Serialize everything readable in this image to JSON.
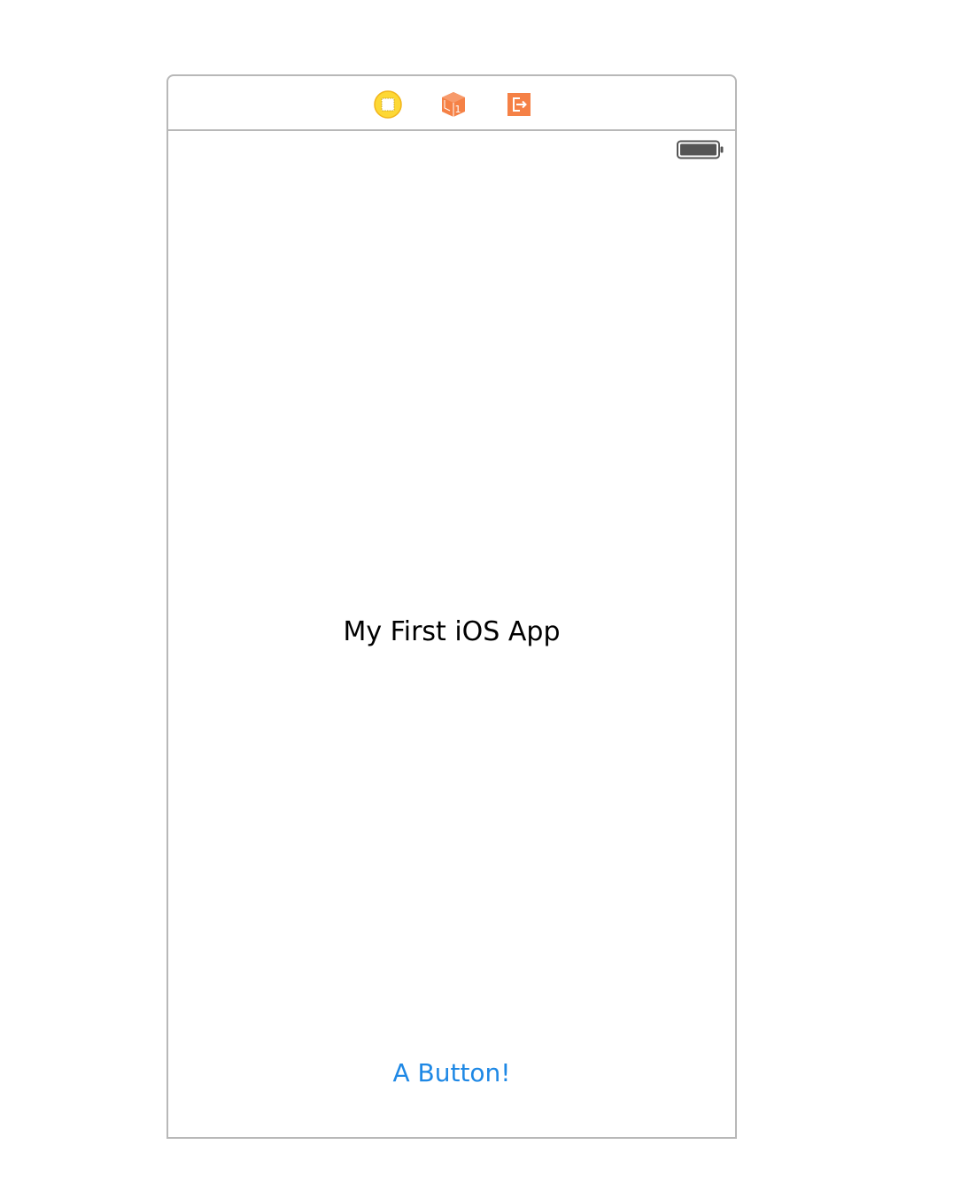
{
  "scene": {
    "dock": {
      "icons": [
        {
          "name": "view-controller-icon",
          "color": "#fdd835"
        },
        {
          "name": "first-responder-icon",
          "color": "#f58146",
          "badge": "1"
        },
        {
          "name": "exit-icon",
          "color": "#f58146"
        }
      ]
    },
    "status_bar": {
      "battery_icon": "battery-full-icon",
      "battery_color": "#555555"
    },
    "label": {
      "text": "My First iOS App",
      "color": "#000000"
    },
    "button": {
      "label": "A Button!",
      "color": "#1e88e5"
    }
  }
}
